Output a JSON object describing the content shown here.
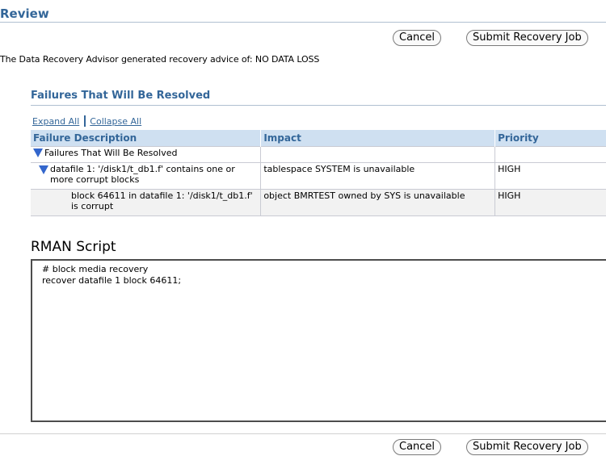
{
  "page": {
    "title": "Review",
    "advice_text": "The Data Recovery Advisor generated recovery advice of: NO DATA LOSS"
  },
  "buttons": {
    "cancel": "Cancel",
    "submit": "Submit Recovery Job"
  },
  "failures_section": {
    "title": "Failures That Will Be Resolved",
    "expand_all": "Expand All",
    "collapse_all": "Collapse All",
    "columns": [
      "Failure Description",
      "Impact",
      "Priority"
    ],
    "group_label": "Failures That Will Be Resolved",
    "rows": [
      {
        "description": "datafile 1: '/disk1/t_db1.f' contains one or more corrupt blocks",
        "impact": "tablespace SYSTEM is unavailable",
        "priority": "HIGH"
      },
      {
        "description": "block 64611 in datafile 1: '/disk1/t_db1.f' is corrupt",
        "impact": "object BMRTEST owned by SYS is unavailable",
        "priority": "HIGH"
      }
    ]
  },
  "rman": {
    "title": "RMAN Script",
    "script": "# block media recovery\nrecover datafile 1 block 64611;"
  },
  "colors": {
    "accent": "#336699",
    "header_bg": "#cfe0f1",
    "expand_icon": "#3366cc"
  },
  "icons": {
    "expand": "triangle-down-icon"
  }
}
